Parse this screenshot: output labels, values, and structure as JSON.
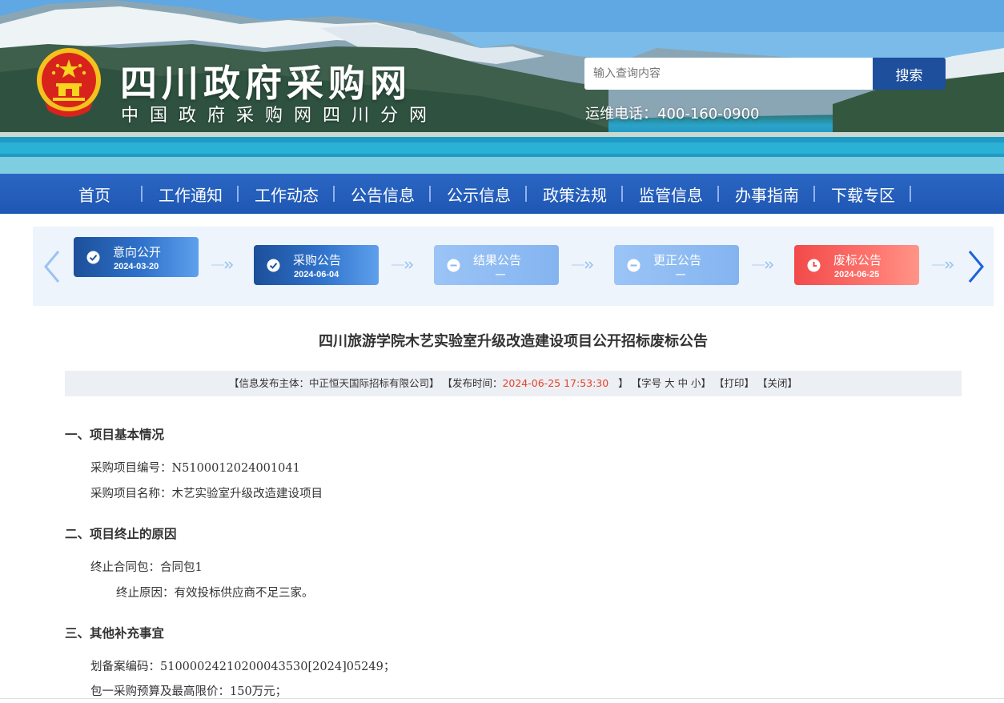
{
  "header": {
    "site_title": "四川政府采购网",
    "site_subtitle": "中国政府采购网四川分网",
    "search_placeholder": "输入查询内容",
    "search_button": "搜索",
    "hotline": "运维电话：400-160-0900"
  },
  "nav": {
    "items": [
      "首页",
      "工作通知",
      "工作动态",
      "公告信息",
      "公示信息",
      "政策法规",
      "监管信息",
      "办事指南",
      "下载专区"
    ]
  },
  "steps": [
    {
      "label": "意向公开",
      "date": "2024-03-20",
      "state": "done"
    },
    {
      "label": "采购公告",
      "date": "2024-06-04",
      "state": "done"
    },
    {
      "label": "结果公告",
      "date": "—",
      "state": "pending"
    },
    {
      "label": "更正公告",
      "date": "—",
      "state": "pending"
    },
    {
      "label": "废标公告",
      "date": "2024-06-25",
      "state": "failed"
    }
  ],
  "colors": {
    "nav_blue": "#1f57b3",
    "search_button": "#1d4f9c",
    "step_done": "#1c4f9a",
    "step_pending": "#9bc4f6",
    "step_failed": "#f24a4a",
    "highlight_red": "#e8402a"
  },
  "article": {
    "title": "四川旅游学院木艺实验室升级改造建设项目公开招标废标公告",
    "meta": {
      "publisher": "【信息发布主体：中正恒天国际招标有限公司】",
      "time_prefix": "【发布时间：",
      "time_value": "2024-06-25 17:53:30",
      "time_suffix": "】",
      "font_size": "【字号 大 中 小】",
      "print": "【打印】",
      "close": "【关闭】"
    },
    "sections": [
      {
        "heading": "一、项目基本情况",
        "lines": [
          "采购项目编号：N5100012024001041",
          "采购项目名称：木艺实验室升级改造建设项目"
        ]
      },
      {
        "heading": "二、项目终止的原因",
        "lines": [
          "终止合同包：合同包1",
          "终止原因：有效投标供应商不足三家。"
        ]
      },
      {
        "heading": "三、其他补充事宜",
        "lines": [
          "划备案编码：51000024210200043530[2024]05249；",
          "包一采购预算及最高限价：150万元；"
        ]
      }
    ]
  }
}
